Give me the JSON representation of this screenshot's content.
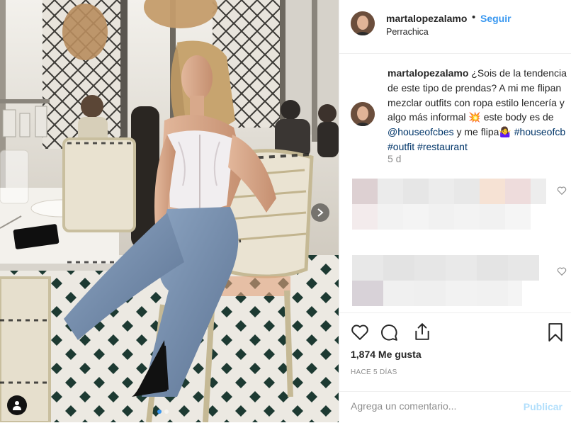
{
  "post": {
    "username": "martalopezalamo",
    "follow_label": "Seguir",
    "separator": "•",
    "location": "Perrachica",
    "caption": {
      "username": "martalopezalamo",
      "text_1": " ¿Sois de la tendencia de este tipo de prendas? A mi me flipan mezclar outfits con ropa estilo lencería y algo más informal ",
      "emoji_1": "💥",
      "text_2": " este body es de ",
      "mention": "@houseofcbes",
      "text_3": " y me flipa",
      "emoji_2": "🤷‍♀️",
      "text_4": " ",
      "hashtag_1": "#houseofcb",
      "hashtag_2": "#outfit",
      "hashtag_3": "#restaurant",
      "age": "5 d"
    },
    "likes": "1,874 Me gusta",
    "timestamp": "HACE 5 DÍAS",
    "comment_placeholder": "Agrega un comentario...",
    "publish_label": "Publicar"
  },
  "colors": {
    "accent": "#3897f0",
    "link": "#003569",
    "publish_disabled": "#b2dffc",
    "muted": "#8e8e8e"
  },
  "icons": [
    "chevron-right-icon",
    "user-tag-icon",
    "heart-icon",
    "comment-icon",
    "share-icon",
    "bookmark-icon"
  ],
  "carousel": {
    "count": 2,
    "active": 0
  }
}
